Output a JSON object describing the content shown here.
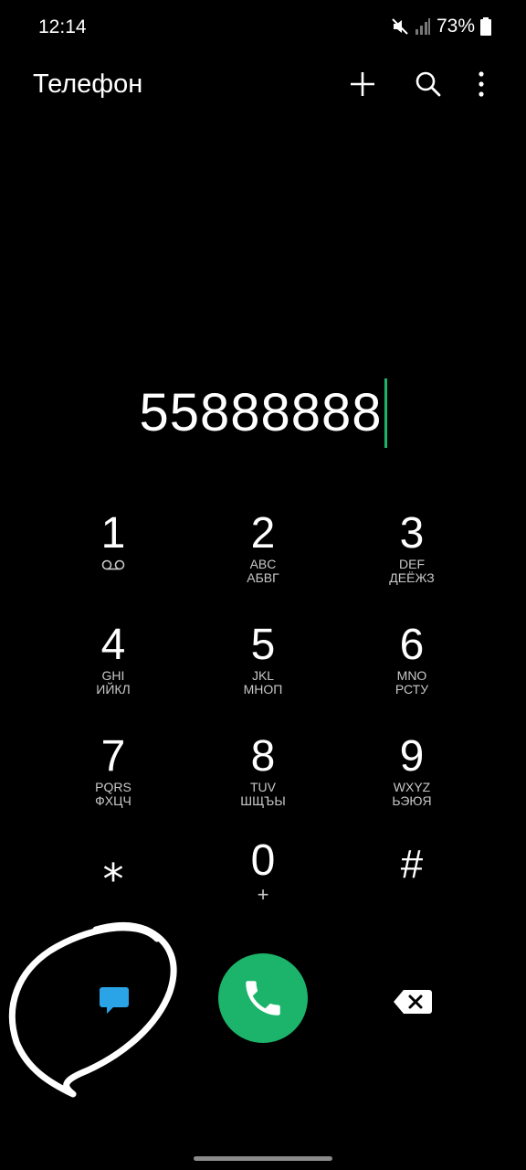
{
  "status": {
    "time": "12:14",
    "battery": "73%"
  },
  "app": {
    "title": "Телефон",
    "icons": {
      "add": "plus-icon",
      "search": "search-icon",
      "more": "more-vertical-icon"
    }
  },
  "dialer": {
    "number": "55888888"
  },
  "keypad": {
    "keys": [
      {
        "digit": "1",
        "latin": "",
        "cyrillic": "",
        "icon": "voicemail-icon"
      },
      {
        "digit": "2",
        "latin": "ABC",
        "cyrillic": "АБВГ"
      },
      {
        "digit": "3",
        "latin": "DEF",
        "cyrillic": "ДЕЁЖЗ"
      },
      {
        "digit": "4",
        "latin": "GHI",
        "cyrillic": "ИЙКЛ"
      },
      {
        "digit": "5",
        "latin": "JKL",
        "cyrillic": "МНОП"
      },
      {
        "digit": "6",
        "latin": "MNO",
        "cyrillic": "РСТУ"
      },
      {
        "digit": "7",
        "latin": "PQRS",
        "cyrillic": "ФХЦЧ"
      },
      {
        "digit": "8",
        "latin": "TUV",
        "cyrillic": "ШЩЪЫ"
      },
      {
        "digit": "9",
        "latin": "WXYZ",
        "cyrillic": "ЬЭЮЯ"
      },
      {
        "digit": "⁎",
        "latin": "",
        "cyrillic": ""
      },
      {
        "digit": "0",
        "latin": "+",
        "cyrillic": ""
      },
      {
        "digit": "#",
        "latin": "",
        "cyrillic": ""
      }
    ]
  },
  "actions": {
    "message_icon": "message-icon",
    "call_icon": "phone-icon",
    "backspace_icon": "backspace-icon"
  },
  "colors": {
    "background": "#000000",
    "call_green": "#1bb46a",
    "message_blue": "#2aa4e6",
    "cursor": "#1bb46a"
  }
}
